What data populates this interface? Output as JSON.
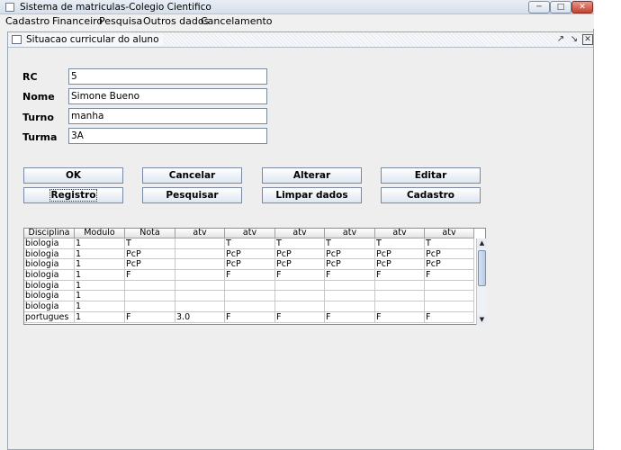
{
  "window": {
    "title": "Sistema de matriculas-Colegio Cientifico"
  },
  "menu": [
    "Cadastro",
    "Financeiro",
    "Pesquisa",
    "Outros dados",
    "Cancelamento"
  ],
  "frame": {
    "title": "Situacao curricular do aluno"
  },
  "form": {
    "rc": {
      "label": "RC",
      "value": "5"
    },
    "nome": {
      "label": "Nome",
      "value": "Simone Bueno"
    },
    "turno": {
      "label": "Turno",
      "value": "manha"
    },
    "turma": {
      "label": "Turma",
      "value": "3A"
    }
  },
  "buttons": {
    "ok": "OK",
    "cancelar": "Cancelar",
    "alterar": "Alterar",
    "editar": "Editar",
    "registro": "Registro",
    "pesquisar": "Pesquisar",
    "limpar": "Limpar dados",
    "cadastro": "Cadastro"
  },
  "table": {
    "headers": [
      "Disciplina",
      "Modulo",
      "Nota",
      "atv",
      "atv",
      "atv",
      "atv",
      "atv",
      "atv"
    ],
    "rows": [
      [
        "biologia",
        "1",
        "T",
        "",
        "T",
        "T",
        "T",
        "T",
        "T"
      ],
      [
        "biologia",
        "1",
        "PcP",
        "",
        "PcP",
        "PcP",
        "PcP",
        "PcP",
        "PcP"
      ],
      [
        "biologia",
        "1",
        "PcP",
        "",
        "PcP",
        "PcP",
        "PcP",
        "PcP",
        "PcP"
      ],
      [
        "biologia",
        "1",
        "F",
        "",
        "F",
        "F",
        "F",
        "F",
        "F"
      ],
      [
        "biologia",
        "1",
        "",
        "",
        "",
        "",
        "",
        "",
        ""
      ],
      [
        "biologia",
        "1",
        "",
        "",
        "",
        "",
        "",
        "",
        ""
      ],
      [
        "biologia",
        "1",
        "",
        "",
        "",
        "",
        "",
        "",
        ""
      ],
      [
        "portugues",
        "1",
        "F",
        "3.0",
        "F",
        "F",
        "F",
        "F",
        "F"
      ]
    ]
  }
}
